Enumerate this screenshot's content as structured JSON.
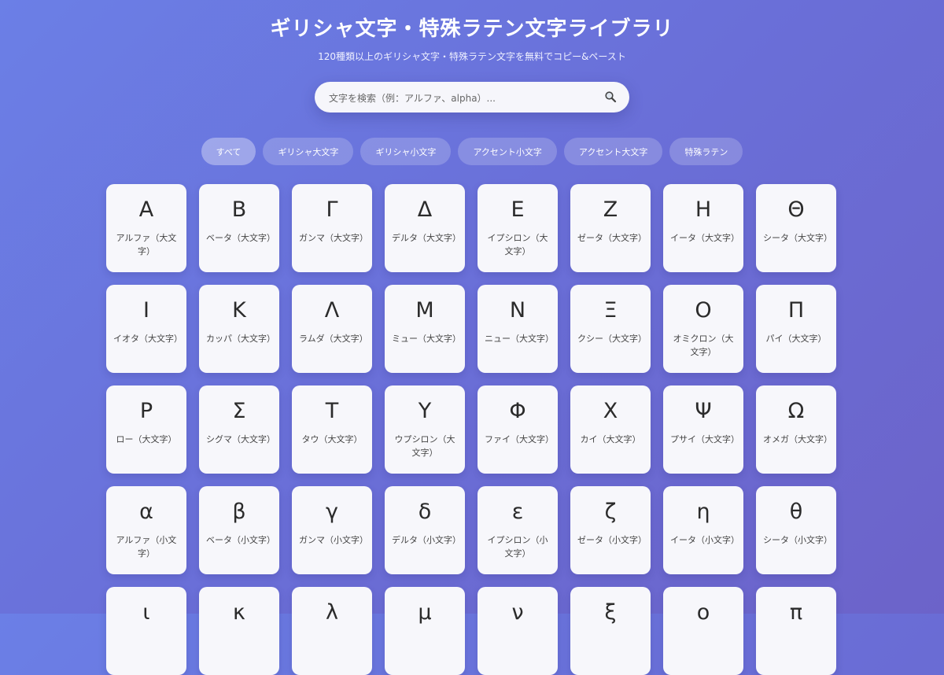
{
  "header": {
    "title": "ギリシャ文字・特殊ラテン文字ライブラリ",
    "subtitle": "120種類以上のギリシャ文字・特殊ラテン文字を無料でコピー&ペースト"
  },
  "search": {
    "placeholder": "文字を検索（例：アルファ、alpha）...",
    "icon": "magnifier-icon"
  },
  "filters": [
    {
      "label": "すべて",
      "active": true
    },
    {
      "label": "ギリシャ大文字",
      "active": false
    },
    {
      "label": "ギリシャ小文字",
      "active": false
    },
    {
      "label": "アクセント小文字",
      "active": false
    },
    {
      "label": "アクセント大文字",
      "active": false
    },
    {
      "label": "特殊ラテン",
      "active": false
    }
  ],
  "characters": [
    {
      "char": "Α",
      "name": "アルファ（大文字）"
    },
    {
      "char": "Β",
      "name": "ベータ（大文字）"
    },
    {
      "char": "Γ",
      "name": "ガンマ（大文字）"
    },
    {
      "char": "Δ",
      "name": "デルタ（大文字）"
    },
    {
      "char": "Ε",
      "name": "イプシロン（大文字）"
    },
    {
      "char": "Ζ",
      "name": "ゼータ（大文字）"
    },
    {
      "char": "Η",
      "name": "イータ（大文字）"
    },
    {
      "char": "Θ",
      "name": "シータ（大文字）"
    },
    {
      "char": "Ι",
      "name": "イオタ（大文字）"
    },
    {
      "char": "Κ",
      "name": "カッパ（大文字）"
    },
    {
      "char": "Λ",
      "name": "ラムダ（大文字）"
    },
    {
      "char": "Μ",
      "name": "ミュー（大文字）"
    },
    {
      "char": "Ν",
      "name": "ニュー（大文字）"
    },
    {
      "char": "Ξ",
      "name": "クシー（大文字）"
    },
    {
      "char": "Ο",
      "name": "オミクロン（大文字）"
    },
    {
      "char": "Π",
      "name": "パイ（大文字）"
    },
    {
      "char": "Ρ",
      "name": "ロー（大文字）"
    },
    {
      "char": "Σ",
      "name": "シグマ（大文字）"
    },
    {
      "char": "Τ",
      "name": "タウ（大文字）"
    },
    {
      "char": "Υ",
      "name": "ウプシロン（大文字）"
    },
    {
      "char": "Φ",
      "name": "ファイ（大文字）"
    },
    {
      "char": "Χ",
      "name": "カイ（大文字）"
    },
    {
      "char": "Ψ",
      "name": "プサイ（大文字）"
    },
    {
      "char": "Ω",
      "name": "オメガ（大文字）"
    },
    {
      "char": "α",
      "name": "アルファ（小文字）"
    },
    {
      "char": "β",
      "name": "ベータ（小文字）"
    },
    {
      "char": "γ",
      "name": "ガンマ（小文字）"
    },
    {
      "char": "δ",
      "name": "デルタ（小文字）"
    },
    {
      "char": "ε",
      "name": "イプシロン（小文字）"
    },
    {
      "char": "ζ",
      "name": "ゼータ（小文字）"
    },
    {
      "char": "η",
      "name": "イータ（小文字）"
    },
    {
      "char": "θ",
      "name": "シータ（小文字）"
    },
    {
      "char": "ι",
      "name": ""
    },
    {
      "char": "κ",
      "name": ""
    },
    {
      "char": "λ",
      "name": ""
    },
    {
      "char": "μ",
      "name": ""
    },
    {
      "char": "ν",
      "name": ""
    },
    {
      "char": "ξ",
      "name": ""
    },
    {
      "char": "ο",
      "name": ""
    },
    {
      "char": "π",
      "name": ""
    }
  ],
  "colors": {
    "background_start": "#6b7fe6",
    "background_end": "#6c63c9",
    "card": "#f7f7fb",
    "text": "#2b2b2b"
  }
}
